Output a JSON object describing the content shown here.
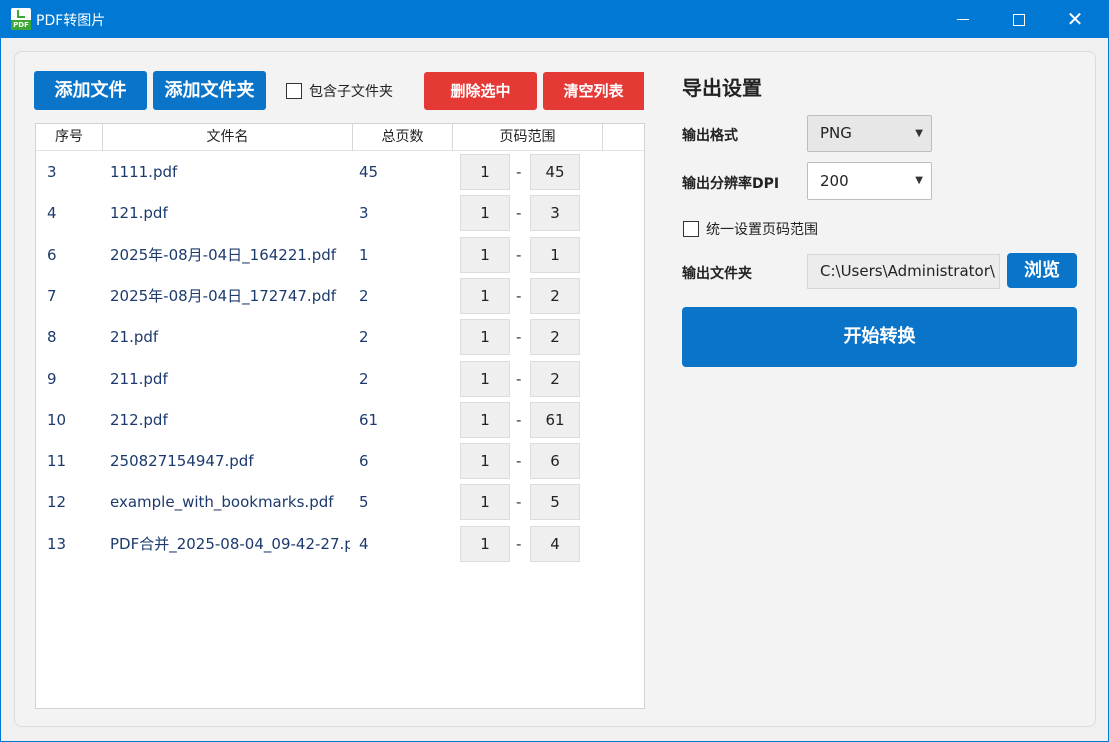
{
  "window": {
    "title": "PDF转图片",
    "icon_text": "PDF"
  },
  "toolbar": {
    "add_files": "添加文件",
    "add_folder": "添加文件夹",
    "include_subfolders": "包含子文件夹",
    "include_subfolders_checked": false,
    "delete_selected": "删除选中",
    "clear_list": "清空列表"
  },
  "table": {
    "headers": [
      "序号",
      "文件名",
      "总页数",
      "页码范围"
    ],
    "range_separator": "-",
    "rows": [
      {
        "index": "3",
        "name": "1111.pdf",
        "pages": "45",
        "from": "1",
        "to": "45"
      },
      {
        "index": "4",
        "name": "121.pdf",
        "pages": "3",
        "from": "1",
        "to": "3"
      },
      {
        "index": "6",
        "name": "2025年-08月-04日_164221.pdf",
        "pages": "1",
        "from": "1",
        "to": "1"
      },
      {
        "index": "7",
        "name": "2025年-08月-04日_172747.pdf",
        "pages": "2",
        "from": "1",
        "to": "2"
      },
      {
        "index": "8",
        "name": "21.pdf",
        "pages": "2",
        "from": "1",
        "to": "2"
      },
      {
        "index": "9",
        "name": "211.pdf",
        "pages": "2",
        "from": "1",
        "to": "2"
      },
      {
        "index": "10",
        "name": "212.pdf",
        "pages": "61",
        "from": "1",
        "to": "61"
      },
      {
        "index": "11",
        "name": "250827154947.pdf",
        "pages": "6",
        "from": "1",
        "to": "6"
      },
      {
        "index": "12",
        "name": "example_with_bookmarks.pdf",
        "pages": "5",
        "from": "1",
        "to": "5"
      },
      {
        "index": "13",
        "name": "PDF合并_2025-08-04_09-42-27.p",
        "pages": "4",
        "from": "1",
        "to": "4"
      }
    ]
  },
  "settings": {
    "title": "导出设置",
    "format_label": "输出格式",
    "format_value": "PNG",
    "dpi_label": "输出分辨率DPI",
    "dpi_value": "200",
    "unified_range_label": "统一设置页码范围",
    "unified_range_checked": false,
    "output_folder_label": "输出文件夹",
    "output_folder_value": "C:\\Users\\Administrator\\",
    "browse": "浏览",
    "start": "开始转换"
  },
  "colors": {
    "titlebar": "#0078d4",
    "primary_button": "#0a74c9",
    "danger_button": "#e53935",
    "table_text": "#1c3a6e"
  },
  "icons": {
    "minimize": "minimize-icon",
    "maximize": "maximize-icon",
    "close": "close-icon",
    "dropdown": "chevron-down-icon"
  }
}
